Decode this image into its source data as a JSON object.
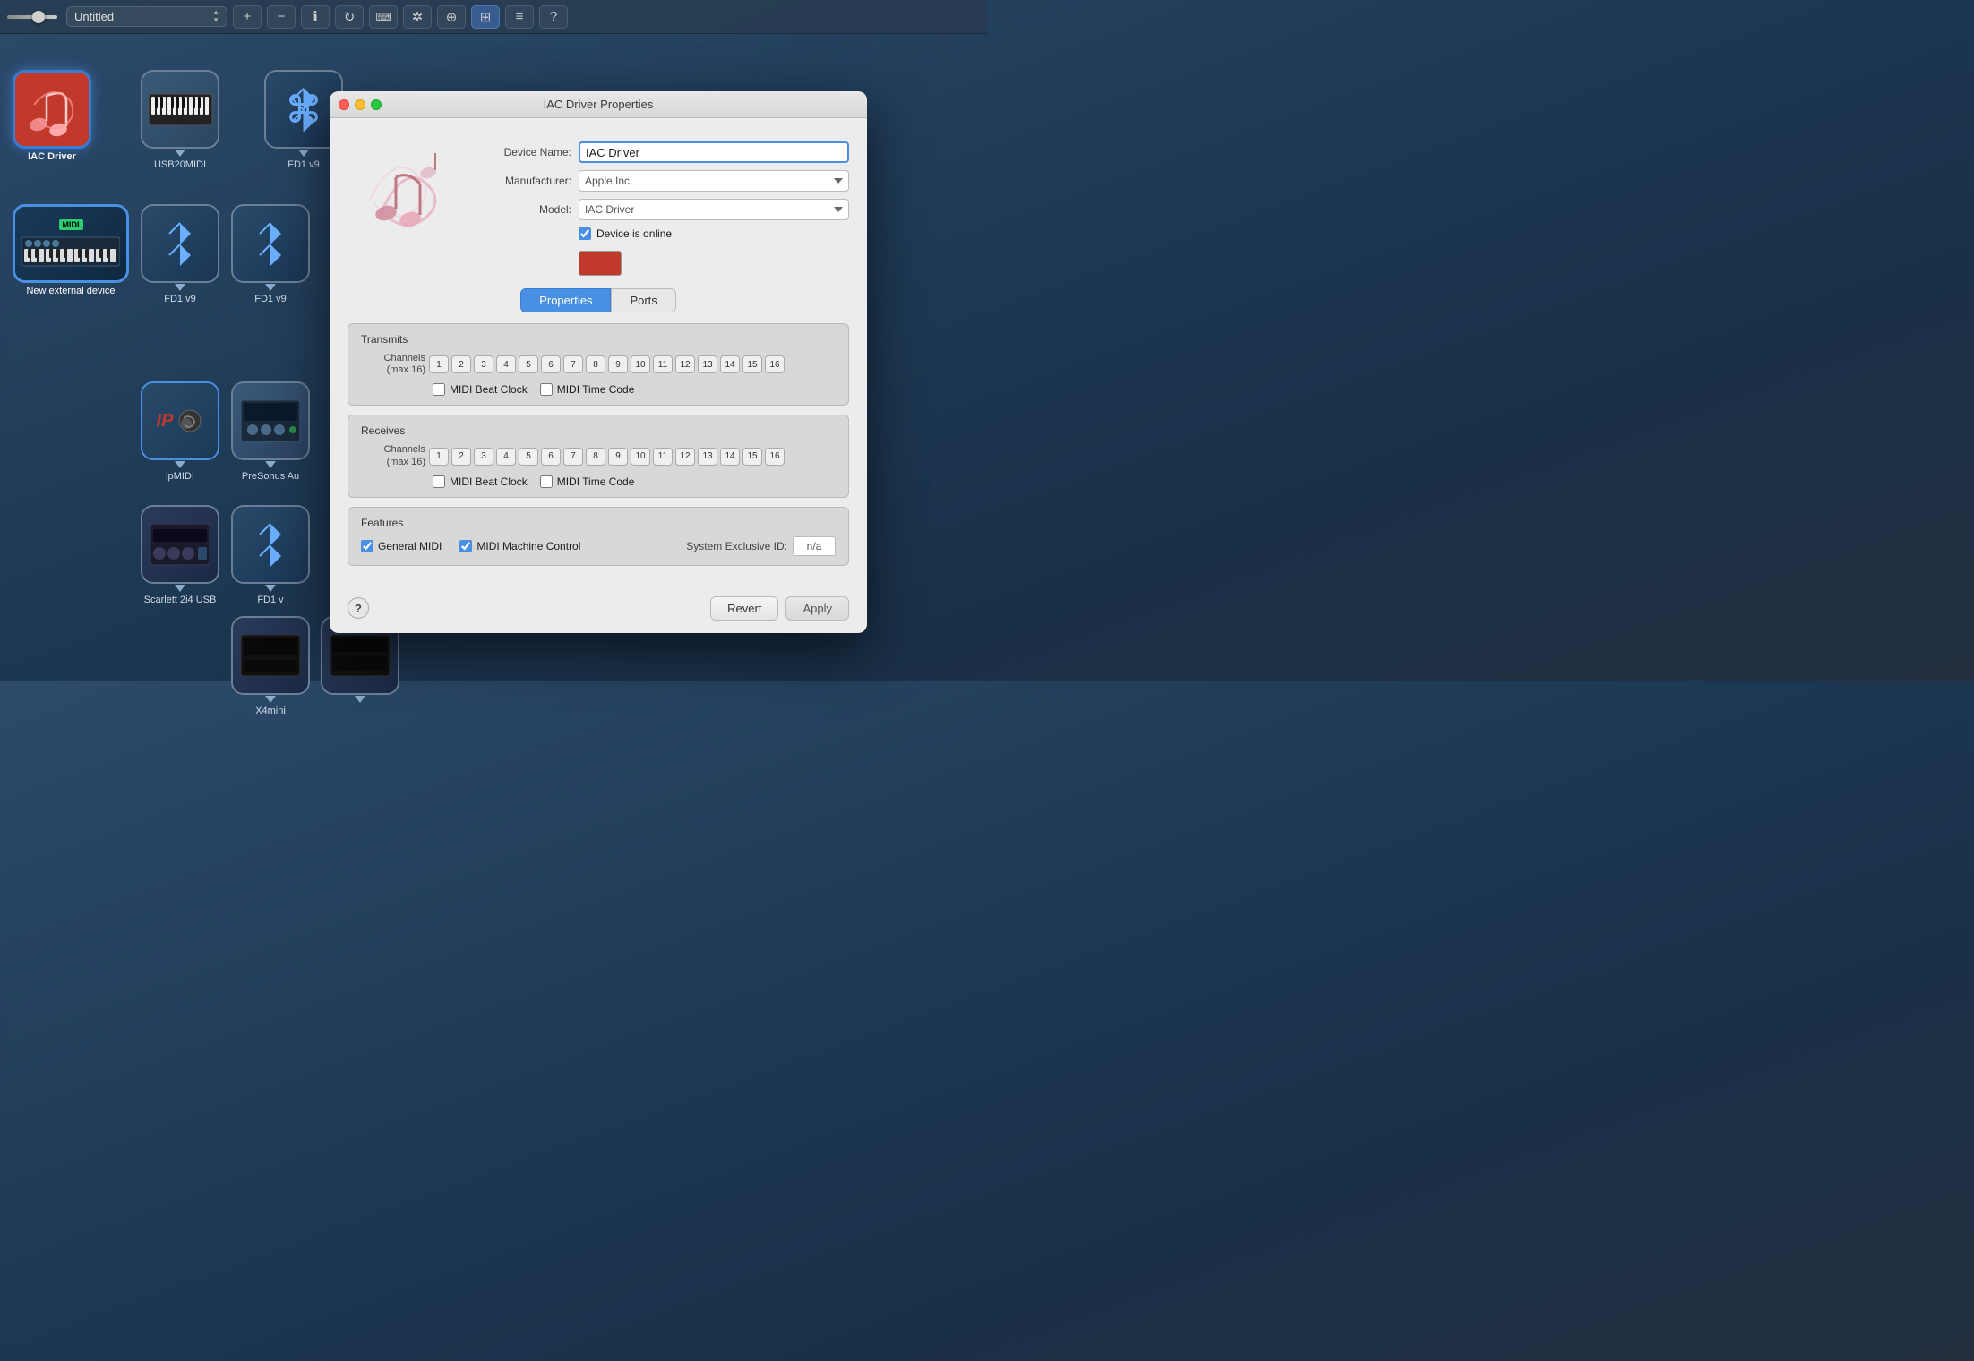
{
  "titlebar": {
    "document_title": "Untitled",
    "buttons": {
      "add": "+",
      "remove": "−",
      "info": "ⓘ",
      "refresh": "↻",
      "keyboard": "⌨",
      "bluetooth": "✦",
      "network": "⊕",
      "screen": "⊞",
      "list": "≡",
      "help": "?"
    }
  },
  "devices": [
    {
      "id": "iac-driver",
      "name": "IAC Driver",
      "type": "iac",
      "selected": true
    },
    {
      "id": "usb20midi",
      "name": "USB20MIDI",
      "type": "usb"
    },
    {
      "id": "fd1v9-1",
      "name": "FD1 v9",
      "type": "bluetooth"
    },
    {
      "id": "new-external",
      "name": "New external device",
      "type": "keyboard"
    },
    {
      "id": "fd1v9-2",
      "name": "FD1 v9",
      "type": "bluetooth"
    },
    {
      "id": "fd1v9-3",
      "name": "FD1 v9",
      "type": "bluetooth"
    },
    {
      "id": "ipmidi",
      "name": "ipMIDI",
      "type": "ip"
    },
    {
      "id": "presonus",
      "name": "PreSonus Au",
      "type": "audio"
    },
    {
      "id": "scarlett",
      "name": "Scarlett 2i4 USB",
      "type": "audio"
    },
    {
      "id": "fd1v9-4",
      "name": "FD1 v",
      "type": "bluetooth"
    },
    {
      "id": "x4mini",
      "name": "X4mini",
      "type": "audio"
    }
  ],
  "dialog": {
    "title": "IAC Driver Properties",
    "device_name_label": "Device Name:",
    "device_name_value": "IAC Driver",
    "manufacturer_label": "Manufacturer:",
    "manufacturer_value": "Apple Inc.",
    "model_label": "Model:",
    "model_value": "IAC Driver",
    "device_online_label": "Device is online",
    "device_online_checked": true,
    "tabs": {
      "properties": "Properties",
      "ports": "Ports"
    },
    "transmits": {
      "title": "Transmits",
      "channels_label": "Channels\n(max 16)",
      "channels": [
        "1",
        "2",
        "3",
        "4",
        "5",
        "6",
        "7",
        "8",
        "9",
        "10",
        "11",
        "12",
        "13",
        "14",
        "15",
        "16"
      ],
      "midi_beat_clock_label": "MIDI Beat Clock",
      "midi_beat_clock_checked": false,
      "midi_time_code_label": "MIDI Time Code",
      "midi_time_code_checked": false
    },
    "receives": {
      "title": "Receives",
      "channels_label": "Channels\n(max 16)",
      "channels": [
        "1",
        "2",
        "3",
        "4",
        "5",
        "6",
        "7",
        "8",
        "9",
        "10",
        "11",
        "12",
        "13",
        "14",
        "15",
        "16"
      ],
      "midi_beat_clock_label": "MIDI Beat Clock",
      "midi_beat_clock_checked": false,
      "midi_time_code_label": "MIDI Time Code",
      "midi_time_code_checked": false
    },
    "features": {
      "title": "Features",
      "general_midi_label": "General MIDI",
      "general_midi_checked": true,
      "midi_machine_control_label": "MIDI Machine Control",
      "midi_machine_control_checked": true,
      "sysex_id_label": "System Exclusive ID:",
      "sysex_id_value": "n/a"
    },
    "buttons": {
      "revert": "Revert",
      "apply": "Apply",
      "help": "?"
    }
  }
}
